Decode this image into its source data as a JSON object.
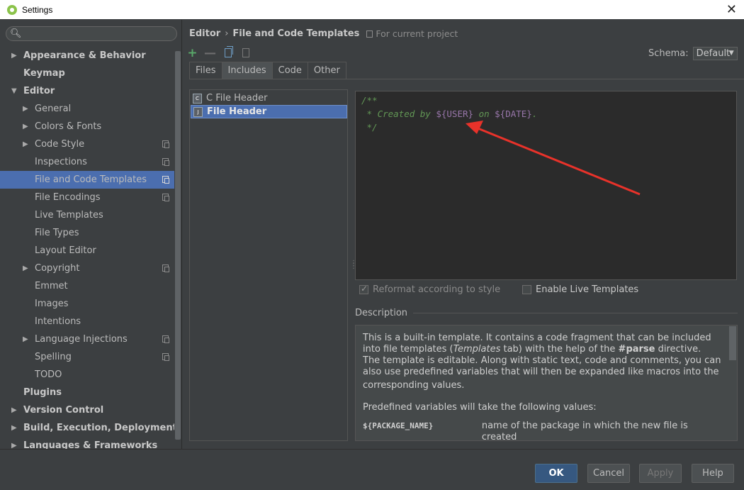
{
  "window": {
    "title": "Settings"
  },
  "search": {
    "placeholder": ""
  },
  "tree": [
    {
      "label": "Appearance & Behavior",
      "bold": true,
      "arrow": "▶",
      "level": 0
    },
    {
      "label": "Keymap",
      "bold": true,
      "arrow": "",
      "level": 0
    },
    {
      "label": "Editor",
      "bold": true,
      "arrow": "▼",
      "level": 0
    },
    {
      "label": "General",
      "arrow": "▶",
      "level": 1
    },
    {
      "label": "Colors & Fonts",
      "arrow": "▶",
      "level": 1
    },
    {
      "label": "Code Style",
      "arrow": "▶",
      "level": 1,
      "project": true
    },
    {
      "label": "Inspections",
      "arrow": "",
      "level": 1,
      "project": true
    },
    {
      "label": "File and Code Templates",
      "arrow": "",
      "level": 1,
      "project": true,
      "selected": true
    },
    {
      "label": "File Encodings",
      "arrow": "",
      "level": 1,
      "project": true
    },
    {
      "label": "Live Templates",
      "arrow": "",
      "level": 1
    },
    {
      "label": "File Types",
      "arrow": "",
      "level": 1
    },
    {
      "label": "Layout Editor",
      "arrow": "",
      "level": 1
    },
    {
      "label": "Copyright",
      "arrow": "▶",
      "level": 1,
      "project": true
    },
    {
      "label": "Emmet",
      "arrow": "",
      "level": 1
    },
    {
      "label": "Images",
      "arrow": "",
      "level": 1
    },
    {
      "label": "Intentions",
      "arrow": "",
      "level": 1
    },
    {
      "label": "Language Injections",
      "arrow": "▶",
      "level": 1,
      "project": true
    },
    {
      "label": "Spelling",
      "arrow": "",
      "level": 1,
      "project": true
    },
    {
      "label": "TODO",
      "arrow": "",
      "level": 1
    },
    {
      "label": "Plugins",
      "bold": true,
      "arrow": "",
      "level": 0
    },
    {
      "label": "Version Control",
      "bold": true,
      "arrow": "▶",
      "level": 0
    },
    {
      "label": "Build, Execution, Deployment",
      "bold": true,
      "arrow": "▶",
      "level": 0
    },
    {
      "label": "Languages & Frameworks",
      "bold": true,
      "arrow": "▶",
      "level": 0
    }
  ],
  "breadcrumb": {
    "parent": "Editor",
    "separator": "›",
    "current": "File and Code Templates",
    "scope": "For current project"
  },
  "schema": {
    "label": "Schema:",
    "value": "Default"
  },
  "tabs": [
    "Files",
    "Includes",
    "Code",
    "Other"
  ],
  "active_tab": "Includes",
  "templates": [
    {
      "label": "C File Header",
      "icon": "C"
    },
    {
      "label": "File Header",
      "icon": "J",
      "selected": true
    }
  ],
  "editor": {
    "line1": "/**",
    "line2_prefix": " * Created by ",
    "line2_var1": "${USER}",
    "line2_mid": " on ",
    "line2_var2": "${DATE}",
    "line2_suffix": ".",
    "line3": " */"
  },
  "options": {
    "reformat_label": "Reformat according to style",
    "reformat_checked": true,
    "live_label": "Enable Live Templates",
    "live_checked": false
  },
  "description": {
    "title": "Description",
    "p1_a": "This is a built-in template. It contains a code fragment that can be included into file templates (",
    "p1_em": "Templates",
    "p1_b": " tab) with the help of the ",
    "p1_bold": "#parse",
    "p1_c": " directive.",
    "p2": "The template is editable. Along with static text, code and comments, you can also use predefined variables that will then be expanded like macros into the",
    "p2_end": "corresponding values.",
    "p3": "Predefined variables will take the following values:",
    "var_name": "${PACKAGE_NAME}",
    "var_desc": "name of the package in which the new file is created"
  },
  "buttons": {
    "ok": "OK",
    "cancel": "Cancel",
    "apply": "Apply",
    "help": "Help"
  },
  "colors": {
    "selection": "#4b6eaf",
    "background": "#3c3f41",
    "editor_bg": "#2b2b2b",
    "comment": "#629755",
    "variable": "#9876aa",
    "annotation_arrow": "#e8322a"
  }
}
